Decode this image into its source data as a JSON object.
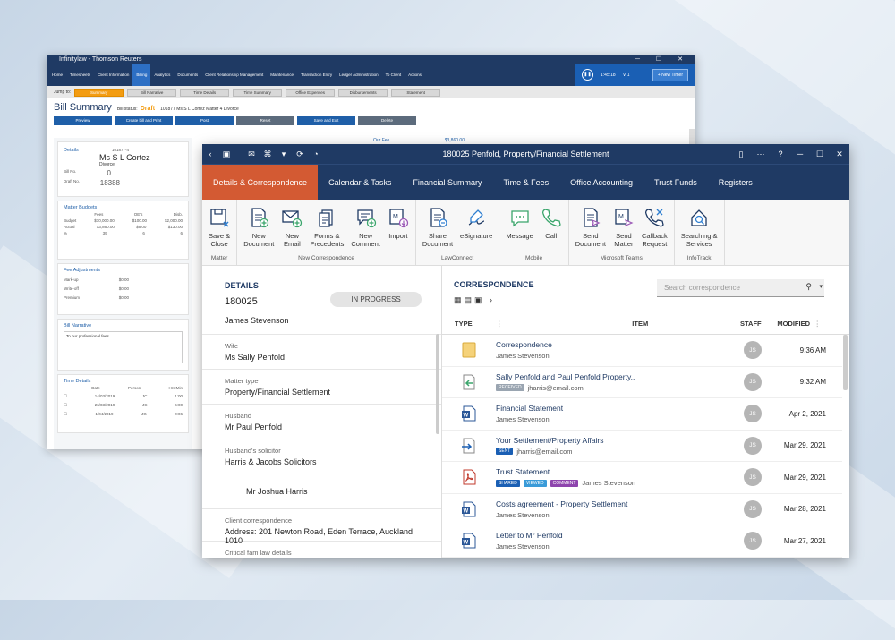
{
  "back_window": {
    "title": "Infinitylaw - Thomson Reuters",
    "nav": [
      "Home",
      "Timesheets",
      "Client Information",
      "Billing",
      "Analytics",
      "Documents",
      "Client Relationship Management",
      "Maintenance",
      "Transaction Entry",
      "Ledger Administration",
      "To Client",
      "Actions"
    ],
    "timer": {
      "value": "1:45:18",
      "count": "1",
      "new_timer": "+ New Timer"
    },
    "jump_label": "Jump to:",
    "jump_tabs": [
      "Summary",
      "Bill Narrative",
      "Time Details",
      "Time Summary",
      "Office Expenses",
      "Disbursements",
      "Statement"
    ],
    "heading": "Bill Summary",
    "status_label": "Bill status:",
    "status": "Draft",
    "matter": "101877 Ms S L Cortez Matter 4 Divorce",
    "buttons": [
      "Preview",
      "Create bill and Print",
      "Post",
      "Reset",
      "Save and Exit",
      "Delete"
    ],
    "details": {
      "label": "Details",
      "id": "101877-4",
      "name": "Ms S L Cortez",
      "type": "Divorce",
      "bill_no_label": "Bill No.",
      "bill_no": "0",
      "draft_no_label": "Draft No.",
      "draft_no": "18388"
    },
    "budgets": {
      "label": "Matter Budgets",
      "cols": [
        "Fees",
        "OE's",
        "Disb."
      ],
      "rows": [
        [
          "Budget",
          "$10,000.00",
          "$100.00",
          "$2,000.00"
        ],
        [
          "Actual",
          "$3,860.00",
          "$6.00",
          "$130.00"
        ],
        [
          "%",
          "39",
          "6",
          "6"
        ]
      ]
    },
    "fee_adj": {
      "label": "Fee Adjustments",
      "rows": [
        [
          "Mark-up",
          "$0.00"
        ],
        [
          "Write-off",
          "$0.00"
        ],
        [
          "Premium",
          "$0.00"
        ]
      ]
    },
    "narrative": {
      "label": "Bill Narrative",
      "text": "To our professional fees"
    },
    "time_details": {
      "label": "Time Details",
      "cols": [
        "Date",
        "Person",
        "Hrs:Min"
      ],
      "rows": [
        [
          "14/03/2019",
          "JC",
          "1:00"
        ],
        [
          "26/03/2019",
          "JC",
          "6:00"
        ],
        [
          "1/04/2019",
          "JG",
          "0:06"
        ]
      ]
    },
    "our_fee": {
      "label": "Our Fee",
      "value": "$3,860.00"
    }
  },
  "front_window": {
    "title": "180025 Penfold, Property/Financial Settlement",
    "tabs": [
      "Details & Correspondence",
      "Calendar & Tasks",
      "Financial Summary",
      "Time & Fees",
      "Office Accounting",
      "Trust Funds",
      "Registers"
    ],
    "ribbon": [
      {
        "group": "Matter",
        "buttons": [
          "Save & Close"
        ]
      },
      {
        "group": "New Correspondence",
        "buttons": [
          "New Document",
          "New Email",
          "Forms & Precedents",
          "New Comment",
          "Import"
        ]
      },
      {
        "group": "LawConnect",
        "buttons": [
          "Share Document",
          "eSignature"
        ]
      },
      {
        "group": "Mobile",
        "buttons": [
          "Message",
          "Call"
        ]
      },
      {
        "group": "Microsoft Teams",
        "buttons": [
          "Send Document",
          "Send Matter",
          "Callback Request"
        ]
      },
      {
        "group": "InfoTrack",
        "buttons": [
          "Searching & Services"
        ]
      }
    ],
    "details": {
      "heading": "DETAILS",
      "matter_no": "180025",
      "status": "IN PROGRESS",
      "client": "James Stevenson",
      "fields": [
        {
          "label": "Wife",
          "value": "Ms Sally Penfold"
        },
        {
          "label": "Matter type",
          "value": "Property/Financial Settlement"
        },
        {
          "label": "Husband",
          "value": "Mr Paul Penfold"
        },
        {
          "label": "Husband's solicitor",
          "value": "Harris & Jacobs Solicitors"
        },
        {
          "label": "",
          "value": "Mr Joshua Harris"
        },
        {
          "label": "Client correspondence",
          "value": "Address: 201 Newton Road, Eden Terrace, Auckland 1010"
        },
        {
          "label": "Critical fam law details",
          "value": ""
        }
      ]
    },
    "correspondence": {
      "heading": "CORRESPONDENCE",
      "search_placeholder": "Search correspondence",
      "columns": {
        "type": "TYPE",
        "item": "ITEM",
        "staff": "STAFF",
        "modified": "MODIFIED"
      },
      "rows": [
        {
          "icon": "folder-icon",
          "title": "Correspondence",
          "sub": "James Stevenson",
          "tags": [],
          "staff": "JS",
          "modified": "9:36 AM"
        },
        {
          "icon": "email-received-icon",
          "title": "Sally Penfold and Paul Penfold Property..",
          "sub": "jharris@email.com",
          "tags": [
            "RECEIVED"
          ],
          "staff": "JS",
          "modified": "9:32 AM"
        },
        {
          "icon": "word-doc-icon",
          "title": "Financial Statement",
          "sub": "James Stevenson",
          "tags": [],
          "staff": "JS",
          "modified": "Apr 2, 2021"
        },
        {
          "icon": "email-sent-icon",
          "title": "Your Settlement/Property Affairs",
          "sub": "jharris@email.com",
          "tags": [
            "SENT"
          ],
          "staff": "JS",
          "modified": "Mar 29, 2021"
        },
        {
          "icon": "pdf-icon",
          "title": "Trust Statement",
          "sub": "James Stevenson",
          "tags": [
            "SHARED",
            "VIEWED",
            "COMMENT"
          ],
          "staff": "JS",
          "modified": "Mar 29, 2021"
        },
        {
          "icon": "word-doc-icon",
          "title": "Costs agreement - Property Settlement",
          "sub": "James Stevenson",
          "tags": [],
          "staff": "JS",
          "modified": "Mar 28, 2021"
        },
        {
          "icon": "word-doc-icon",
          "title": "Letter to Mr Penfold",
          "sub": "James Stevenson",
          "tags": [],
          "staff": "JS",
          "modified": "Mar 27, 2021"
        }
      ]
    }
  },
  "colors": {
    "navy": "#1f3a64",
    "accent": "#d35a33",
    "blue": "#1a5fb4",
    "orange": "#f39c12"
  }
}
